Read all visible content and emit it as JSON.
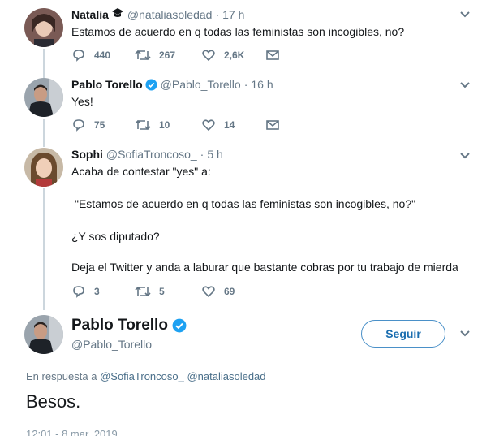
{
  "tweets": [
    {
      "name": "Natalia",
      "handle": "@nataliasoledad",
      "dot": "·",
      "time": "17 h",
      "text": "Estamos de acuerdo en q todas las feministas son incogibles, no?",
      "replies": "440",
      "retweets": "267",
      "likes": "2,6K"
    },
    {
      "name": "Pablo Torello",
      "handle": "@Pablo_Torello",
      "dot": "·",
      "time": "16 h",
      "text": "Yes!",
      "replies": "75",
      "retweets": "10",
      "likes": "14"
    },
    {
      "name": "Sophi",
      "handle": "@SofiaTroncoso_",
      "dot": "·",
      "time": "5 h",
      "lines": [
        "Acaba de contestar \"yes\" a:",
        "\"Estamos de acuerdo en q todas las feministas son incogibles, no?\"",
        "¿Y sos diputado?",
        "Deja el Twitter y anda a laburar que bastante cobras por tu trabajo de mierda"
      ],
      "replies": "3",
      "retweets": "5",
      "likes": "69"
    }
  ],
  "main": {
    "name": "Pablo Torello",
    "handle": "@Pablo_Torello",
    "follow_label": "Seguir",
    "reply_prefix": "En respuesta a",
    "mention1": "@SofiaTroncoso_",
    "mention2": "@nataliasoledad",
    "text": "Besos.",
    "timestamp": "12:01 - 8 mar. 2019"
  },
  "colors": {
    "verified": "#1da1f2",
    "icon": "#657786",
    "follow_border": "#4a90c8"
  }
}
